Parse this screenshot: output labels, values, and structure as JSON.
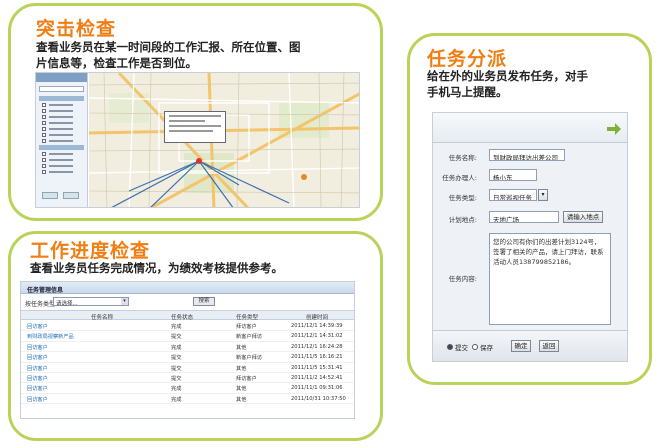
{
  "panel_track": {
    "title": "突击检查",
    "desc_line1": "查看业务员在某一时间段的工作汇报、所在位置、图",
    "desc_line2": "片信息等，检查工作是否到位。"
  },
  "panel_progress": {
    "title": "工作进度检查",
    "desc": "查看业务员任务完成情况，为绩效考核提供参考。",
    "table": {
      "header": "任务管理信息",
      "filter_label": "按任务类型:",
      "filter_value": "请选择...",
      "query_button": "搜索",
      "columns": [
        "任务名称",
        "任务状态",
        "任务类型",
        "创建时间"
      ],
      "rows": [
        {
          "name": "回访客户",
          "status": "完成",
          "type": "拜访客户",
          "time": "2011/12/1 14:39:39"
        },
        {
          "name": "到财政局视察新产品",
          "status": "提交",
          "type": "新客户拜访",
          "time": "2011/12/1 14:31:02"
        },
        {
          "name": "回访客户",
          "status": "完成",
          "type": "其他",
          "time": "2011/12/1 16:24:28"
        },
        {
          "name": "回访客户",
          "status": "提交",
          "type": "新客户拜访",
          "time": "2011/11/5 16:16:21"
        },
        {
          "name": "回访客户",
          "status": "提交",
          "type": "其他",
          "time": "2011/11/5 15:31:41"
        },
        {
          "name": "回访客户",
          "status": "提交",
          "type": "拜访客户",
          "time": "2011/11/2 14:52:41"
        },
        {
          "name": "回访客户",
          "status": "完成",
          "type": "其他",
          "time": "2011/11/1 09:31:06"
        },
        {
          "name": "回访客户",
          "status": "完成",
          "type": "其他",
          "time": "2011/10/31 10:37:50"
        }
      ]
    }
  },
  "panel_assign": {
    "title": "任务分派",
    "desc_line1": "给在外的业务员发布任务，对手",
    "desc_line2": "手机马上提醒。",
    "form": {
      "name_label": "任务名称:",
      "name_value": "到财政局拜访出差公司",
      "handler_label": "任务办理人:",
      "handler_value": "杨小东",
      "type_label": "任务类型:",
      "type_value": "日常巡视任务",
      "place_label": "计划地点:",
      "place_value": "天地广场",
      "place_button": "请输入地点",
      "content_label": "任务内容:",
      "content_value": "您的公司有你们的出差计划3124号，签署了相关的产品，请上门拜访，联系活动人员138799852186。",
      "opt_submit": "提交",
      "opt_save": "保存",
      "confirm_button": "确定",
      "back_button": "返回"
    }
  },
  "colors": {
    "card_border": "#b9d35a",
    "title": "#f07e14",
    "arrow": "#7fb13a"
  }
}
